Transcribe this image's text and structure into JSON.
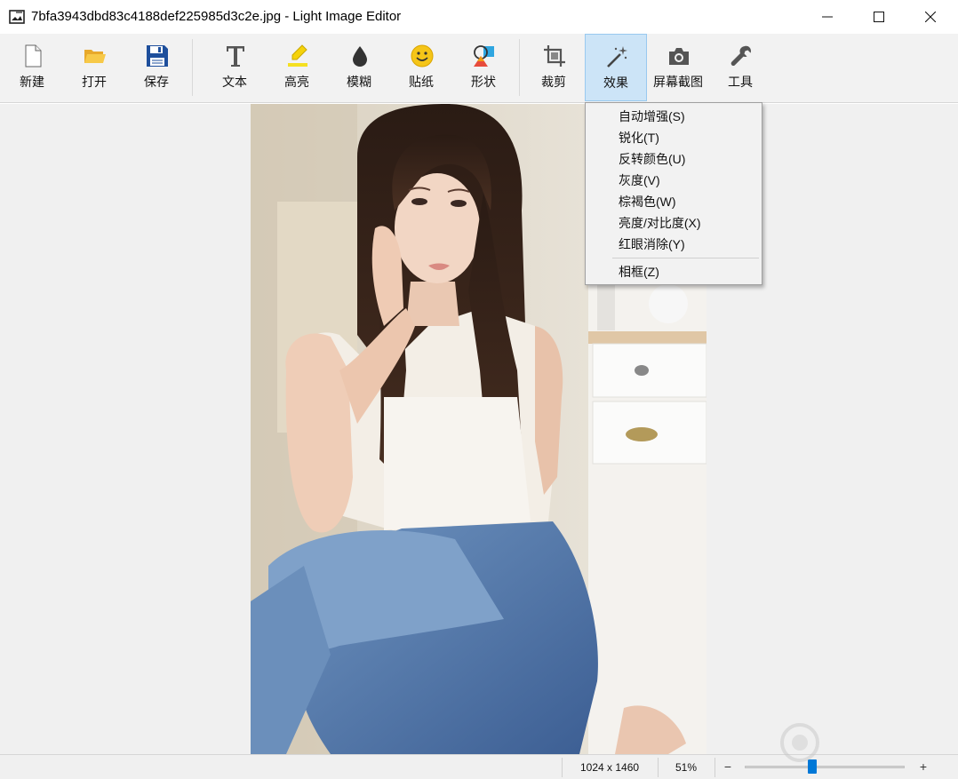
{
  "window": {
    "title": "7bfa3943dbd83c4188def225985d3c2e.jpg - Light Image Editor"
  },
  "toolbar": {
    "tools": [
      {
        "id": "new",
        "label": "新建",
        "icon": "new-file-icon"
      },
      {
        "id": "open",
        "label": "打开",
        "icon": "folder-open-icon"
      },
      {
        "id": "save",
        "label": "保存",
        "icon": "floppy-disk-icon"
      },
      {
        "id": "text",
        "label": "文本",
        "icon": "text-t-icon"
      },
      {
        "id": "highlight",
        "label": "高亮",
        "icon": "highlighter-icon"
      },
      {
        "id": "blur",
        "label": "模糊",
        "icon": "drop-icon"
      },
      {
        "id": "sticker",
        "label": "贴纸",
        "icon": "smiley-icon"
      },
      {
        "id": "shape",
        "label": "形状",
        "icon": "shapes-icon"
      },
      {
        "id": "crop",
        "label": "裁剪",
        "icon": "crop-icon"
      },
      {
        "id": "effects",
        "label": "效果",
        "icon": "magic-wand-icon",
        "active": true
      },
      {
        "id": "screenshot",
        "label": "屏幕截图",
        "icon": "camera-icon"
      },
      {
        "id": "tools",
        "label": "工具",
        "icon": "wrench-icon"
      }
    ]
  },
  "effects_menu": {
    "items": [
      {
        "label": "自动增强(S)"
      },
      {
        "label": "锐化(T)"
      },
      {
        "label": "反转颜色(U)"
      },
      {
        "label": "灰度(V)"
      },
      {
        "label": "棕褐色(W)"
      },
      {
        "label": "亮度/对比度(X)"
      },
      {
        "label": "红眼消除(Y)"
      },
      {
        "label": "相框(Z)"
      }
    ]
  },
  "statusbar": {
    "dimensions": "1024 x 1460",
    "zoom": "51%",
    "zoom_out": "−",
    "zoom_in": "+",
    "zoom_level_fraction": 0.42
  },
  "colors": {
    "active_tool_bg": "#cce4f7",
    "zoom_thumb": "#0078d7"
  }
}
